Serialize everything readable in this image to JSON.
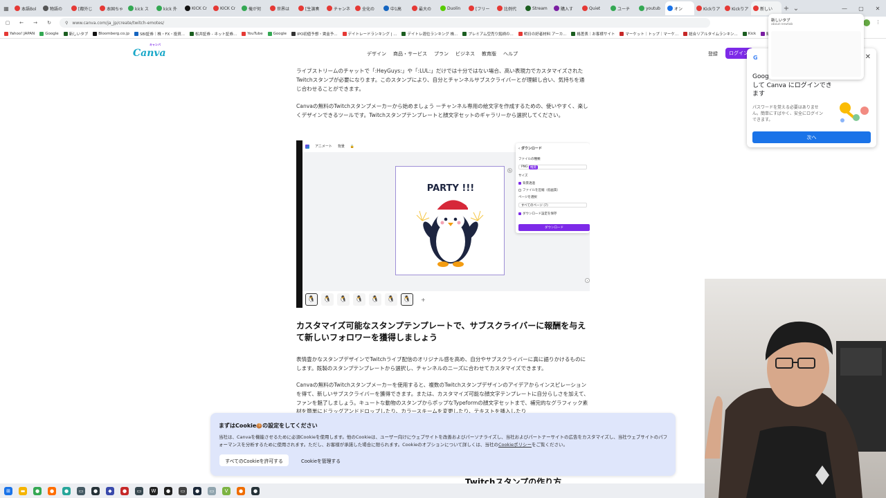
{
  "browser": {
    "tabs": [
      {
        "label": "本語Bol",
        "color": "#e53935"
      },
      {
        "label": "物語の",
        "color": "#555555"
      },
      {
        "label": "[都外じ",
        "color": "#e53935"
      },
      {
        "label": "本国ちゃ",
        "color": "#e53935"
      },
      {
        "label": "kick ス",
        "color": "#34a853"
      },
      {
        "label": "kick 外",
        "color": "#34a853"
      },
      {
        "label": "KICK Cr",
        "color": "#111111"
      },
      {
        "label": "KICK Cr",
        "color": "#e53935"
      },
      {
        "label": "俺が何",
        "color": "#34a853"
      },
      {
        "label": "世界は",
        "color": "#e53935"
      },
      {
        "label": "[生演奏",
        "color": "#e53935"
      },
      {
        "label": "チャンネ",
        "color": "#e53935"
      },
      {
        "label": "全化の",
        "color": "#e53935"
      },
      {
        "label": "中1高",
        "color": "#1565c0"
      },
      {
        "label": "最大の",
        "color": "#e53935"
      },
      {
        "label": "Duolin",
        "color": "#58cc02"
      },
      {
        "label": "[フリー",
        "color": "#e53935"
      },
      {
        "label": "比例代",
        "color": "#e53935"
      },
      {
        "label": "Stream",
        "color": "#1b5e20"
      },
      {
        "label": "購入す",
        "color": "#7b1fa2"
      },
      {
        "label": "Quiet",
        "color": "#e53935"
      },
      {
        "label": "ユーチ",
        "color": "#34a853"
      },
      {
        "label": "youtub",
        "color": "#34a853"
      },
      {
        "label": "オン",
        "color": "#1a73e8"
      },
      {
        "label": "Kickりア",
        "color": "#e53935"
      },
      {
        "label": "Kickりア",
        "color": "#e53935"
      },
      {
        "label": "新しい",
        "color": "#e53935"
      }
    ],
    "url": "www.canva.com/ja_jp/create/twitch-emotes/",
    "bookmarks": [
      {
        "label": "Yahoo! JAPAN",
        "color": "#e53935"
      },
      {
        "label": "Google",
        "color": "#34a853"
      },
      {
        "label": "新しいタブ",
        "color": "#1b5e20"
      },
      {
        "label": "Bloomberg.co.jp",
        "color": "#111111"
      },
      {
        "label": "SBI証券｜株・FX・投資...",
        "color": "#1565c0"
      },
      {
        "label": "松井証券 - ネット証券...",
        "color": "#1b5e20"
      },
      {
        "label": "YouTube",
        "color": "#e53935"
      },
      {
        "label": "Google",
        "color": "#34a853"
      },
      {
        "label": "IPO初値予想・賃金予...",
        "color": "#333333"
      },
      {
        "label": "デイトレードランキング | ...",
        "color": "#e53935"
      },
      {
        "label": "デイトレ週位ランキング 株...",
        "color": "#1b5e20"
      },
      {
        "label": "プレミアム空売り銘柄の...",
        "color": "#1b5e20"
      },
      {
        "label": "明日の好者材料 アーカ...",
        "color": "#e53935"
      },
      {
        "label": "格差表｜お客様サイト",
        "color": "#1b5e20"
      },
      {
        "label": "マーケット｜トップ｜マーケ...",
        "color": "#c62828"
      },
      {
        "label": "総合リアルタイムランキン...",
        "color": "#c62828"
      },
      {
        "label": "Kick",
        "color": "#1b5e20"
      },
      {
        "label": "購入す",
        "color": "#7b1fa2"
      }
    ]
  },
  "canva": {
    "logo": "Canva",
    "logo_tag": "キャンバ",
    "nav": [
      "デザイン",
      "商品・サービス",
      "プラン",
      "ビジネス",
      "教育版",
      "ヘルプ"
    ],
    "signup": "登録",
    "login": "ログイン"
  },
  "article": {
    "p1": "ライブストリームのチャットで「:HeyGuys:」や「:LUL:」だけでは十分ではない場合、高い表現力でカスタマイズされたTwitchスタンプが必要になります。このスタンプにより、自分とチャンネルサブスクライバーとが理解し合い、気持ちを通じ合わせることができます。",
    "p2": "Canvaの無料のTwitchスタンプメーカーから始めましょう ーチャンネル専用の絵文字を作成するための、使いやすく、楽しくデザインできるツールです。Twitchスタンプテンプレートと顔文字セットのギャラリーから選択してください。",
    "h2": "カスタマイズ可能なスタンプテンプレートで、サブスクライバーに報酬を与えて新しいフォロワーを獲得しましょう",
    "p3": "表情豊かなスタンプデザインでTwitchライブ配信のオリジナル感を高め、自分やサブスクライバーに真に語りかけるものにします。既製のスタンプテンプレートから選択し、チャンネルのニーズに合わせてカスタマイズできます。",
    "p4": "Canvaの無料のTwitchスタンプメーカーを使用すると、複数のTwitchスタンプデザインのアイデアからインスピレーションを得て、新しいサブスクライバーを獲得できます。または、カスタマイズ可能な顔文字テンプレートに自分らしさを加えて、ファンを魅了しましょう。キュートな動物のスタンプからポップなTypeformの顔文字セットまで、補完的なグラフィック素材を簡単にドラッグアンドドロップしたり、カラースキームを変更したり、テキストを挿入したり",
    "h3": "Twitchスタンプの作り方"
  },
  "mockup": {
    "topbar": [
      "アニメート",
      "背景"
    ],
    "canvas_text": "PARTY !!!",
    "panel": {
      "title": "ダウンロード",
      "file_type_label": "ファイルの種類",
      "file_type": "PNG",
      "badge": "推奨",
      "size_label": "サイズ",
      "checks": [
        "背景透過",
        "ファイルを圧縮（低画質）"
      ],
      "pages_label": "ページを選択",
      "pages": "すべてのページ (7)",
      "save_setting": "ダウンロード設定を保存",
      "download": "ダウンロード"
    }
  },
  "google_popup": {
    "logo": "G",
    "title": "Google アカウントを使用して Canva にログインできます",
    "desc": "パスワードを覚える必要はありません。簡単にすばやく、安全にログインできます。",
    "next": "次へ"
  },
  "tab_card": {
    "title": "新しいタブ",
    "url": "about:newtab"
  },
  "cookie": {
    "title": "まずはCookieの設定をしてください",
    "emoji": "🍪",
    "body": "当社は、Canvaを機能させるために必須Cookieを使用します。他のCookieは、ユーザー向けにウェブサイトを改善およびパーソナライズし、当社およびパートナーサイトの広告をカスタマイズし、当社ウェブサイトのパフォーマンスを分析するために使用されます。ただし、お客様が承諾した場合に限られます。Cookieのオプションについて詳しくは、当社の",
    "link": "Cookieポリシー",
    "body_end": "をご覧ください。",
    "accept": "すべてのCookieを許可する",
    "manage": "Cookieを管理する"
  },
  "colors": {
    "brand_purple": "#7d2ae8",
    "brand_teal": "#17a7c8",
    "google_blue": "#1a73e8",
    "cookie_bg": "#dfe6fb"
  }
}
